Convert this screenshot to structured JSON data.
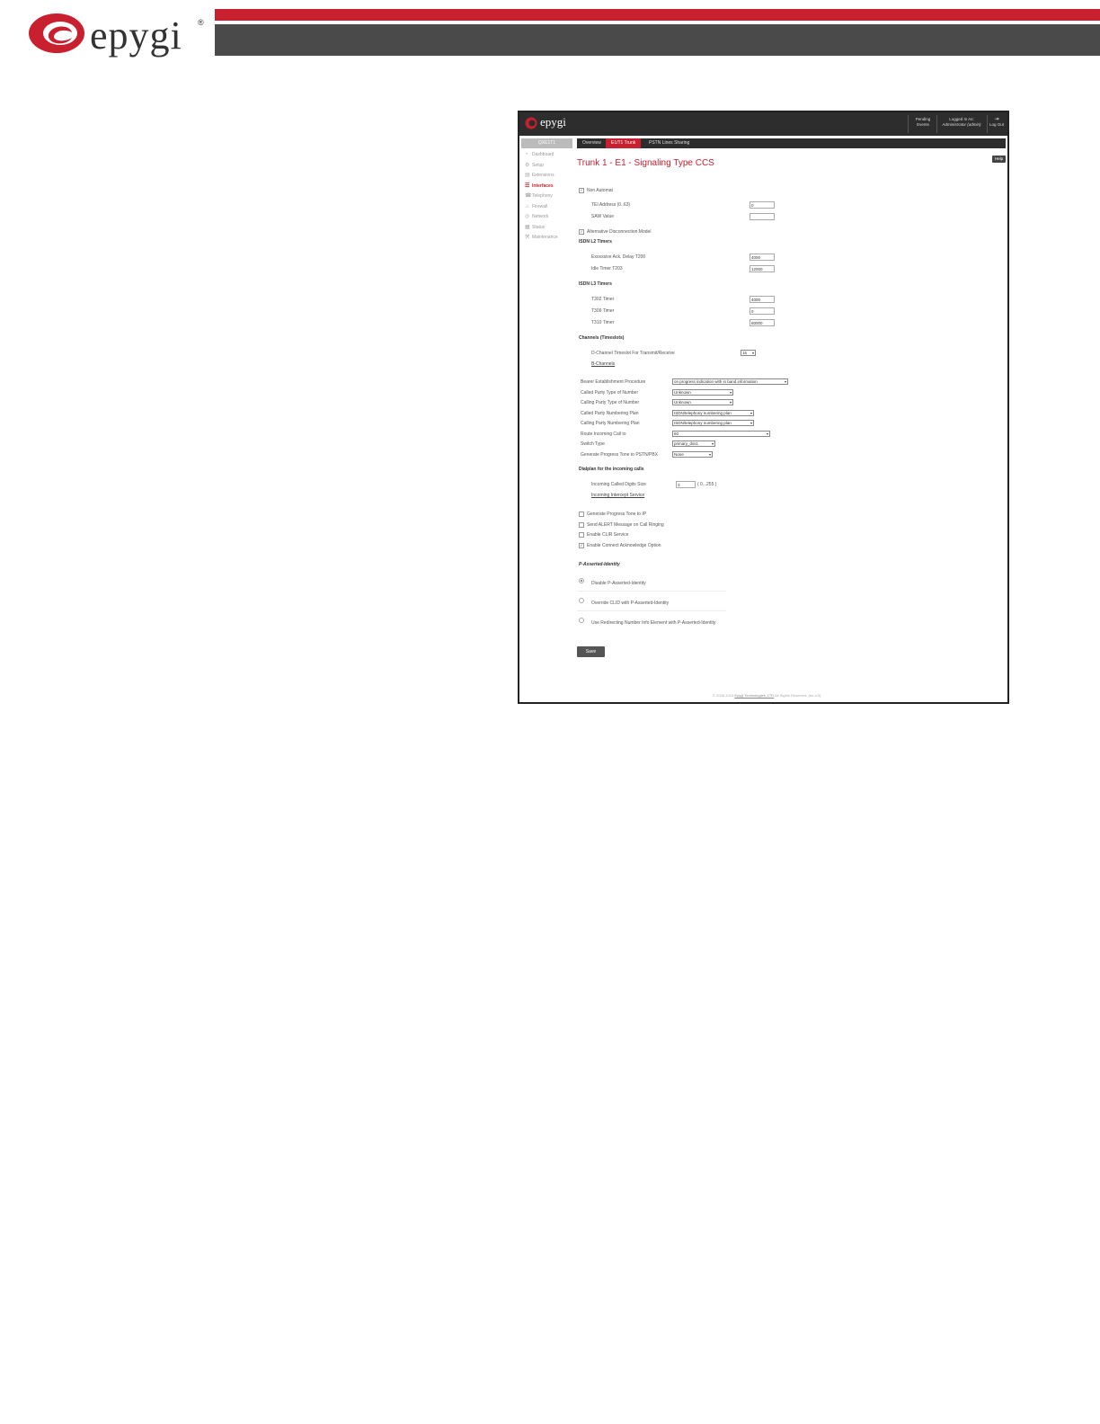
{
  "brand": {
    "name": "epygi",
    "registered": "®",
    "red": "#c8202f",
    "dark": "#4a4a4a"
  },
  "screenshot": {
    "topbar": {
      "logo_text": "epygi",
      "pending": "Pending Events",
      "logged_in_label": "Logged In As:",
      "logged_in_user": "Administrator (admin)",
      "logout": "Log Out"
    },
    "sidebar": {
      "header": "QXE1T1",
      "items": [
        {
          "label": "Dashboard",
          "icon": "dashboard-icon"
        },
        {
          "label": "Setup",
          "icon": "gear-icon"
        },
        {
          "label": "Extensions",
          "icon": "extensions-icon"
        },
        {
          "label": "Interfaces",
          "icon": "interfaces-icon",
          "active": true
        },
        {
          "label": "Telephony",
          "icon": "phone-icon"
        },
        {
          "label": "Firewall",
          "icon": "flame-icon"
        },
        {
          "label": "Network",
          "icon": "globe-icon"
        },
        {
          "label": "Status",
          "icon": "chart-icon"
        },
        {
          "label": "Maintenance",
          "icon": "wrench-icon"
        }
      ]
    },
    "tabs": [
      "Overview",
      "E1/T1 Trunk",
      "PSTN Lines Sharing"
    ],
    "active_tab": "E1/T1 Trunk",
    "page_title": "Trunk 1 - E1 - Signaling Type CCS",
    "help": "Help",
    "non_automat": "Non Automat",
    "tei_address": {
      "label": "TEI Address (0..63)",
      "value": "0"
    },
    "saw_value": {
      "label": "SAW Value",
      "value": ""
    },
    "alt_disconnect": "Alternative Disconnection Model",
    "isdn_l2": {
      "title": "ISDN L2 Timers",
      "t200": {
        "label": "Excessive Ack. Delay T200",
        "value": "4000"
      },
      "t203": {
        "label": "Idle Timer T203",
        "value": "12000"
      }
    },
    "isdn_l3": {
      "title": "ISDN L3 Timers",
      "t302": {
        "label": "T302 Timer",
        "value": "4000"
      },
      "t309": {
        "label": "T309 Timer",
        "value": "0"
      },
      "t310": {
        "label": "T310 Timer",
        "value": "60000"
      }
    },
    "channels": {
      "title": "Channels (Timeslots)",
      "dchannel": {
        "label": "D-Channel Timeslot For Transmit/Receive",
        "value": "16"
      },
      "bchannels": "B-Channels"
    },
    "settings": [
      {
        "label": "Bearer Establishment Procedure",
        "value": "on progress indication with in band information"
      },
      {
        "label": "Called Party Type of Number",
        "value": "Unknown"
      },
      {
        "label": "Calling Party Type of Number",
        "value": "Unknown"
      },
      {
        "label": "Called Party Numbering Plan",
        "value": "ISDN/telephony numbering plan"
      },
      {
        "label": "Calling Party Numbering Plan",
        "value": "ISDN/telephony numbering plan"
      },
      {
        "label": "Route Incoming Call to",
        "value": "60"
      },
      {
        "label": "Switch Type",
        "value": "primary_dss1"
      },
      {
        "label": "Generate Progress Tone to PSTN/PBX",
        "value": "None"
      }
    ],
    "dialplan": {
      "title": "Dialplan for the incoming calls",
      "digits_label": "Incoming Called Digits Size",
      "digits_value": "3",
      "digits_range": "( 0...255 )",
      "intercept_link": "Incoming Intercept Service"
    },
    "options": [
      {
        "label": "Generate Progress Tone to IP",
        "checked": false
      },
      {
        "label": "Send ALERT Message on Call Ringing",
        "checked": false
      },
      {
        "label": "Enable CLIR Service",
        "checked": false
      },
      {
        "label": "Enable Connect Acknowledge Option",
        "checked": true
      }
    ],
    "pai": {
      "title": "P-Asserted-Identity",
      "options": [
        {
          "label": "Disable P-Asserted-Identity",
          "selected": true
        },
        {
          "label": "Override CLID with P-Asserted-Identity",
          "selected": false
        },
        {
          "label": "Use Redirecting Number Info Element with P-Asserted-Identity",
          "selected": false
        }
      ]
    },
    "save": "Save",
    "footer": {
      "prefix": "© 2006-2014",
      "link": "Epygi Technologies, LTD",
      "suffix": "All Rights Reserved. (en-US)"
    }
  }
}
